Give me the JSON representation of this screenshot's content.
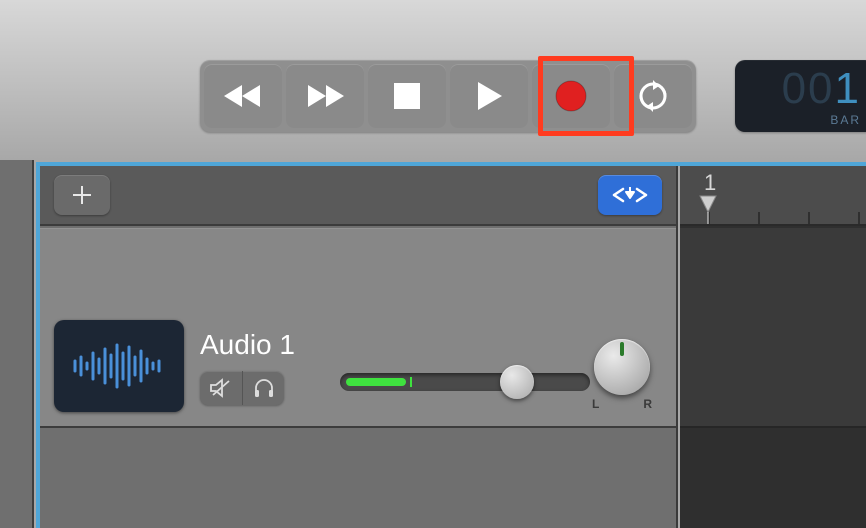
{
  "transport": {
    "rewind": "rewind",
    "forward": "forward",
    "stop": "stop",
    "play": "play",
    "record": "record",
    "cycle": "cycle"
  },
  "lcd": {
    "value_dim": "00",
    "value_bright": "1",
    "label": "BAR"
  },
  "header": {
    "add": "+",
    "catch": "catch-playhead"
  },
  "track": {
    "name": "Audio 1",
    "mute": "mute",
    "monitor": "monitor",
    "pan_left": "L",
    "pan_right": "R"
  },
  "ruler": {
    "bar1": "1"
  }
}
